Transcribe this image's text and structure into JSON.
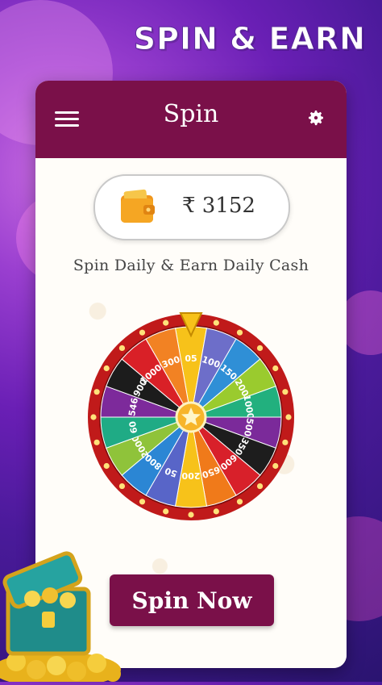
{
  "banner": {
    "text": "SPIN & EARN"
  },
  "appbar": {
    "title": "Spin",
    "menu_icon": "hamburger-icon",
    "settings_icon": "gear-icon"
  },
  "balance": {
    "icon": "wallet-icon",
    "value": "₹ 3152"
  },
  "tagline": "Spin Daily & Earn Daily Cash",
  "wheel": {
    "segments": [
      {
        "label": "05",
        "color": "#f7c21a"
      },
      {
        "label": "100",
        "color": "#6d6ec9"
      },
      {
        "label": "150",
        "color": "#2f8fd6"
      },
      {
        "label": "200",
        "color": "#9acb2e"
      },
      {
        "label": "1000",
        "color": "#22b07e"
      },
      {
        "label": "500",
        "color": "#7b2a9a"
      },
      {
        "label": "350",
        "color": "#1d1d1d"
      },
      {
        "label": "600",
        "color": "#d8202a"
      },
      {
        "label": "650",
        "color": "#f07a1a"
      },
      {
        "label": "200",
        "color": "#f7c21a"
      },
      {
        "label": "50",
        "color": "#5865c8"
      },
      {
        "label": "800",
        "color": "#2b86d4"
      },
      {
        "label": "2000",
        "color": "#8fc33a"
      },
      {
        "label": "60",
        "color": "#1fab85"
      },
      {
        "label": "546",
        "color": "#7d2a9b"
      },
      {
        "label": "900",
        "color": "#1c1c1c"
      },
      {
        "label": "10000",
        "color": "#d92027"
      },
      {
        "label": "300",
        "color": "#f28223"
      }
    ],
    "rim_color": "#c01a1a",
    "hub_icon": "star-icon"
  },
  "spin_button": {
    "label": "Spin Now"
  },
  "decor": {
    "chest_icon": "treasure-chest-icon"
  }
}
